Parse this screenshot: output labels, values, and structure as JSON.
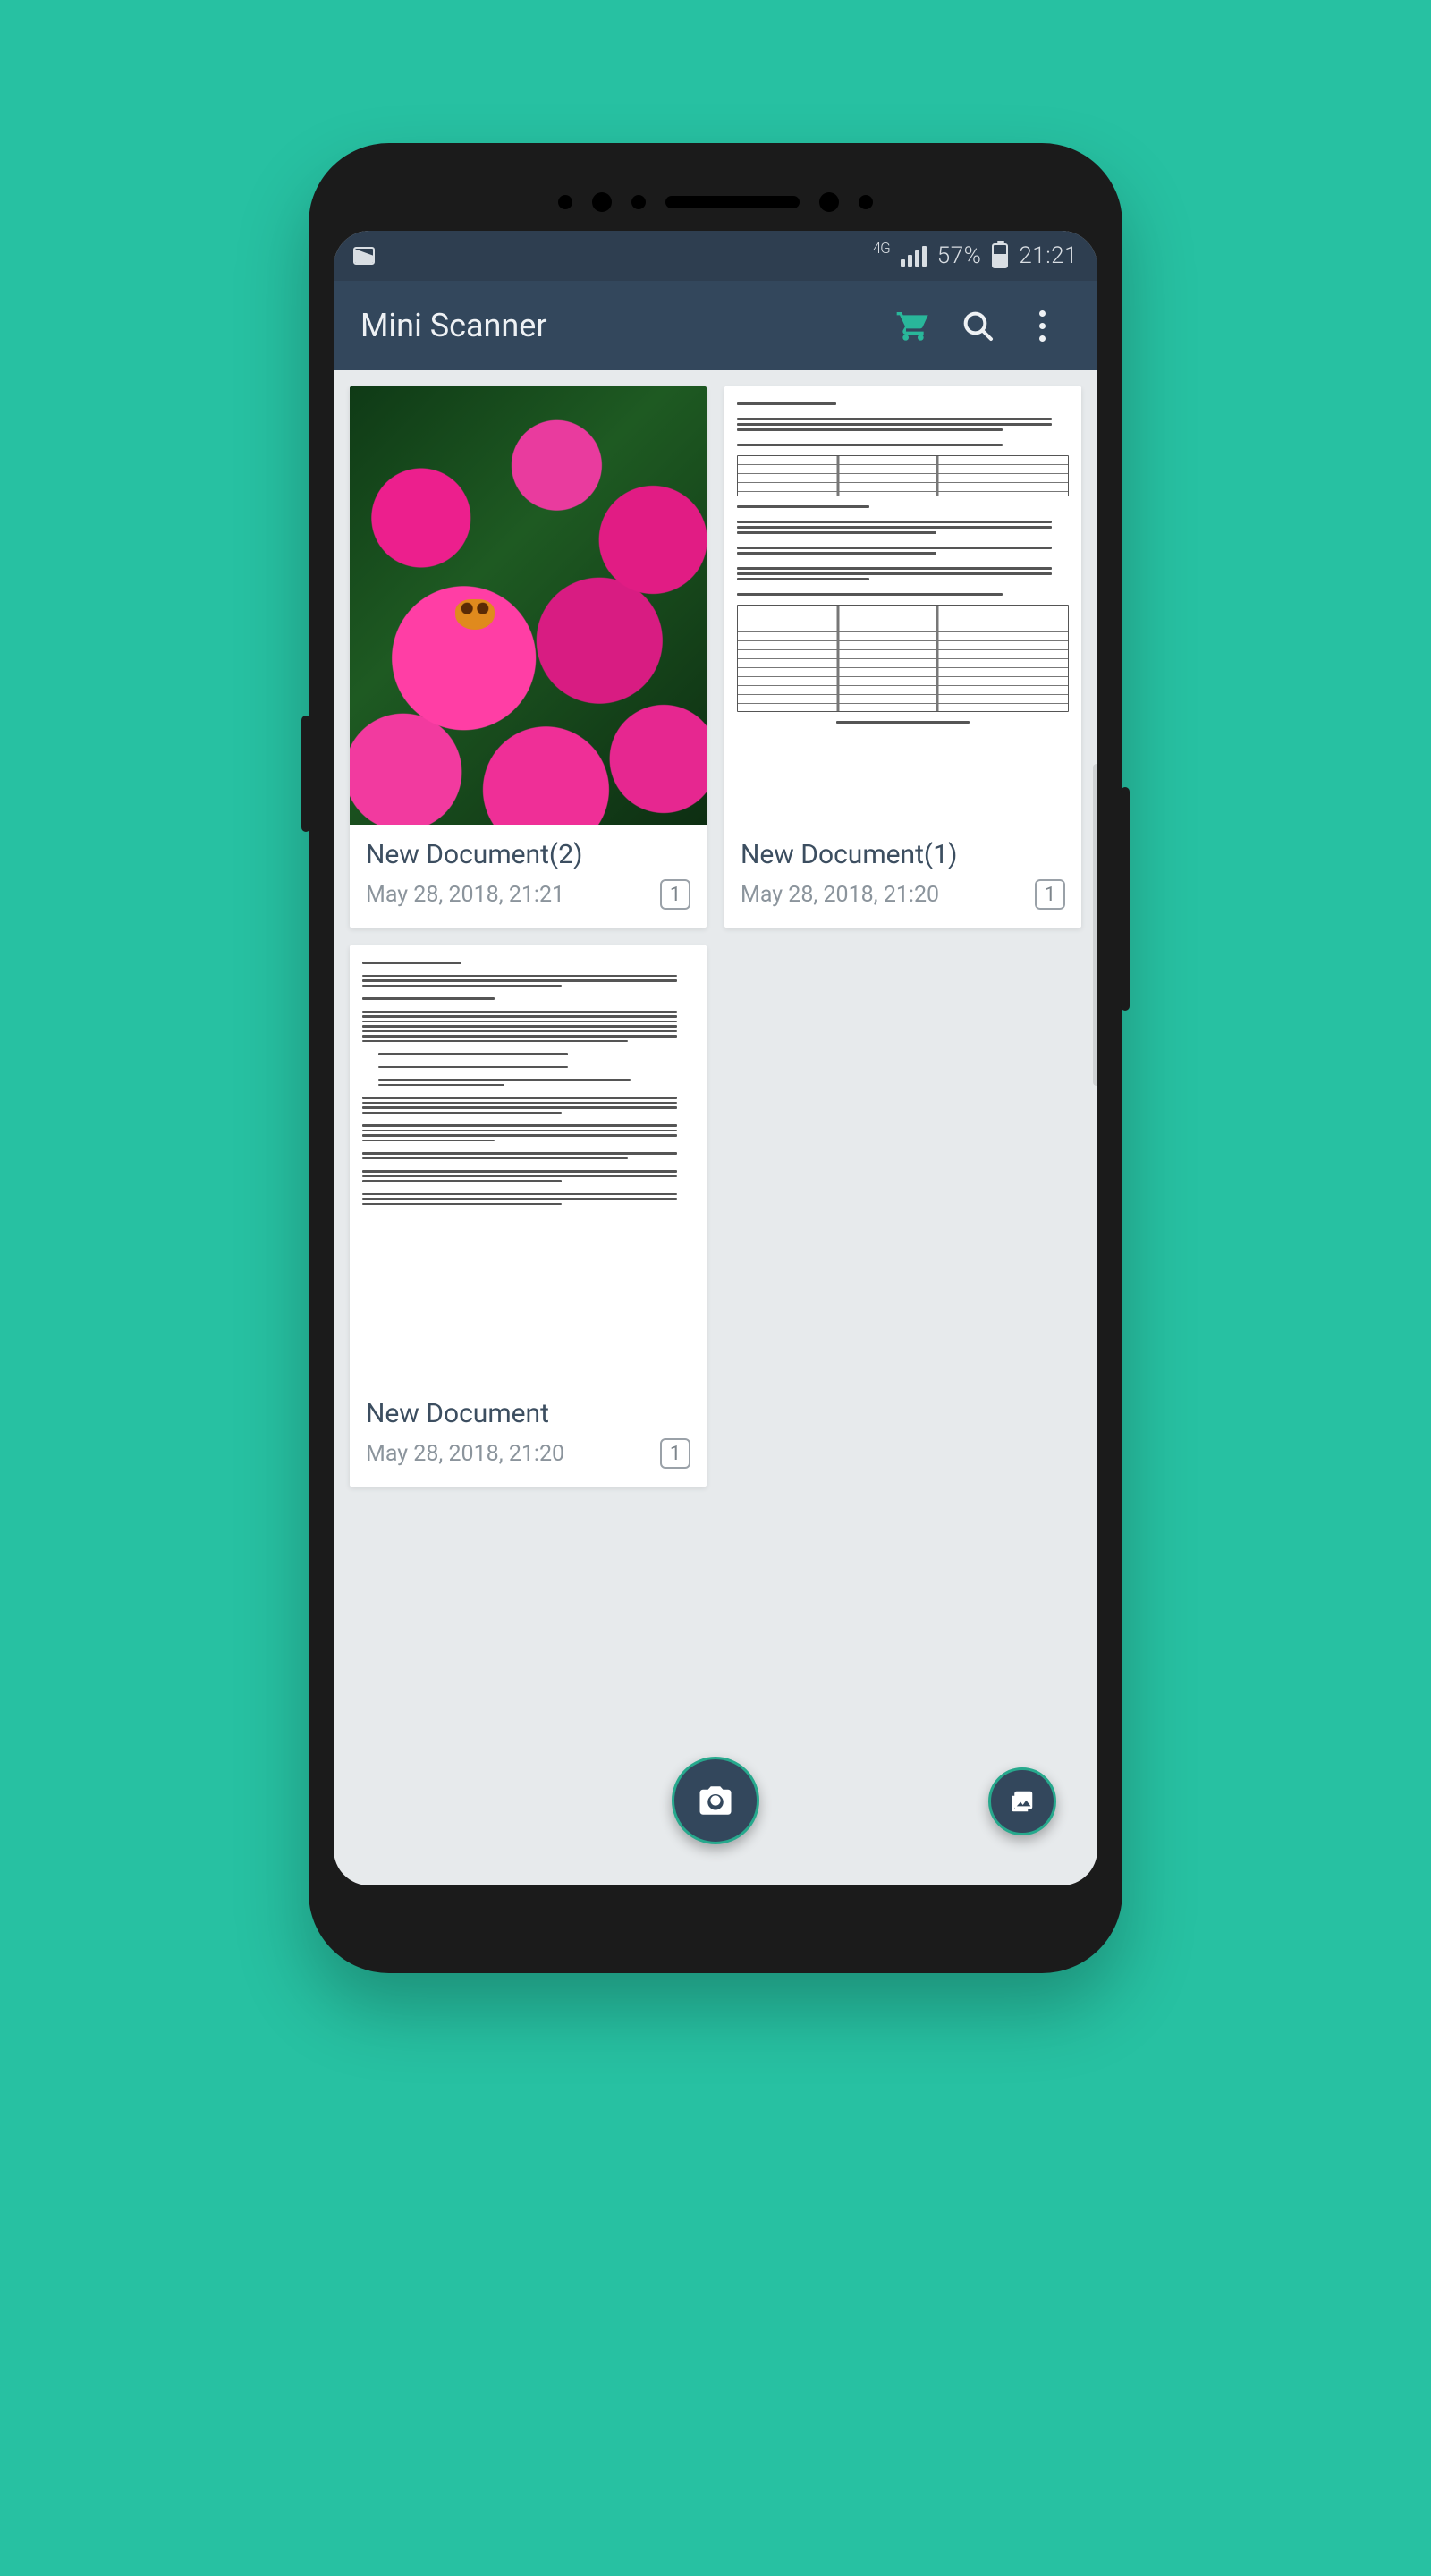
{
  "status": {
    "network": "4G",
    "battery": "57%",
    "time": "21:21"
  },
  "appbar": {
    "title": "Mini Scanner"
  },
  "documents": [
    {
      "title": "New Document(2)",
      "date": "May 28, 2018, 21:21",
      "pages": "1",
      "thumb": "flowers"
    },
    {
      "title": "New Document(1)",
      "date": "May 28, 2018, 21:20",
      "pages": "1",
      "thumb": "tables"
    },
    {
      "title": "New Document",
      "date": "May 28, 2018, 21:20",
      "pages": "1",
      "thumb": "text"
    }
  ]
}
